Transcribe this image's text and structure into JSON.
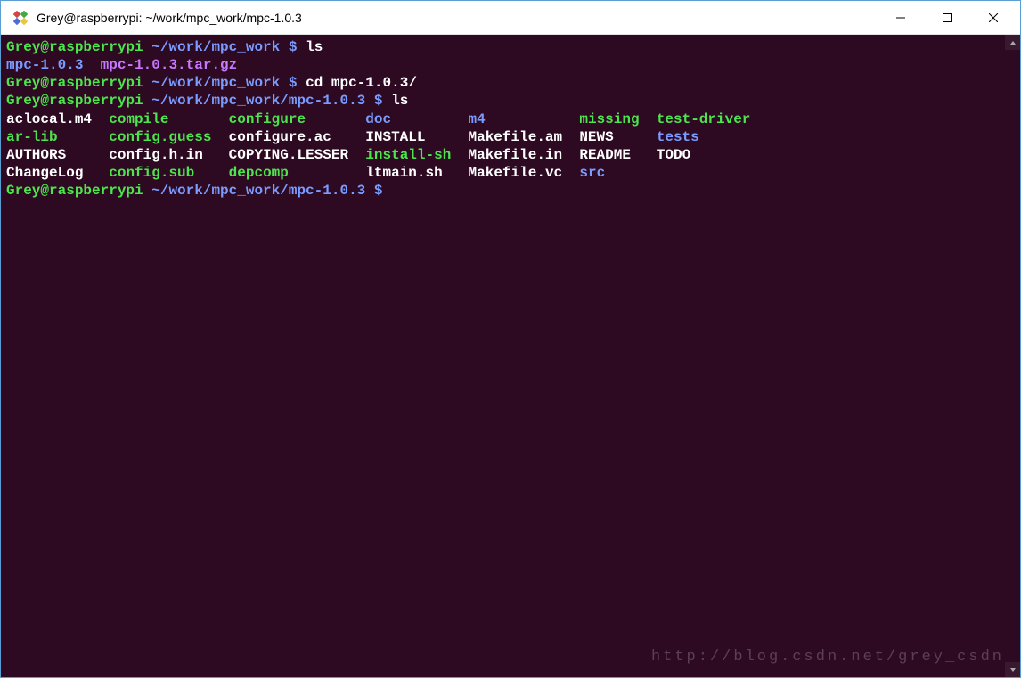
{
  "window": {
    "title": "Grey@raspberrypi: ~/work/mpc_work/mpc-1.0.3"
  },
  "terminal": {
    "prompt1_user": "Grey@raspberrypi",
    "prompt1_path": "~/work/mpc_work",
    "prompt1_dollar": "$",
    "cmd1": "ls",
    "ls1_item1": "mpc-1.0.3",
    "ls1_item2": "mpc-1.0.3.tar.gz",
    "prompt2_user": "Grey@raspberrypi",
    "prompt2_path": "~/work/mpc_work",
    "prompt2_dollar": "$",
    "cmd2": "cd mpc-1.0.3/",
    "prompt3_user": "Grey@raspberrypi",
    "prompt3_path": "~/work/mpc_work/mpc-1.0.3",
    "prompt3_dollar": "$",
    "cmd3": "ls",
    "row1": {
      "c1": "aclocal.m4",
      "c2": "compile",
      "c3": "configure",
      "c4": "doc",
      "c5": "m4",
      "c6": "missing",
      "c7": "test-driver"
    },
    "row2": {
      "c1": "ar-lib",
      "c2": "config.guess",
      "c3": "configure.ac",
      "c4": "INSTALL",
      "c5": "Makefile.am",
      "c6": "NEWS",
      "c7": "tests"
    },
    "row3": {
      "c1": "AUTHORS",
      "c2": "config.h.in",
      "c3": "COPYING.LESSER",
      "c4": "install-sh",
      "c5": "Makefile.in",
      "c6": "README",
      "c7": "TODO"
    },
    "row4": {
      "c1": "ChangeLog",
      "c2": "config.sub",
      "c3": "depcomp",
      "c4": "ltmain.sh",
      "c5": "Makefile.vc",
      "c6": "src",
      "c7": ""
    },
    "prompt4_user": "Grey@raspberrypi",
    "prompt4_path": "~/work/mpc_work/mpc-1.0.3",
    "prompt4_dollar": "$"
  },
  "watermark": "http://blog.csdn.net/grey_csdn"
}
